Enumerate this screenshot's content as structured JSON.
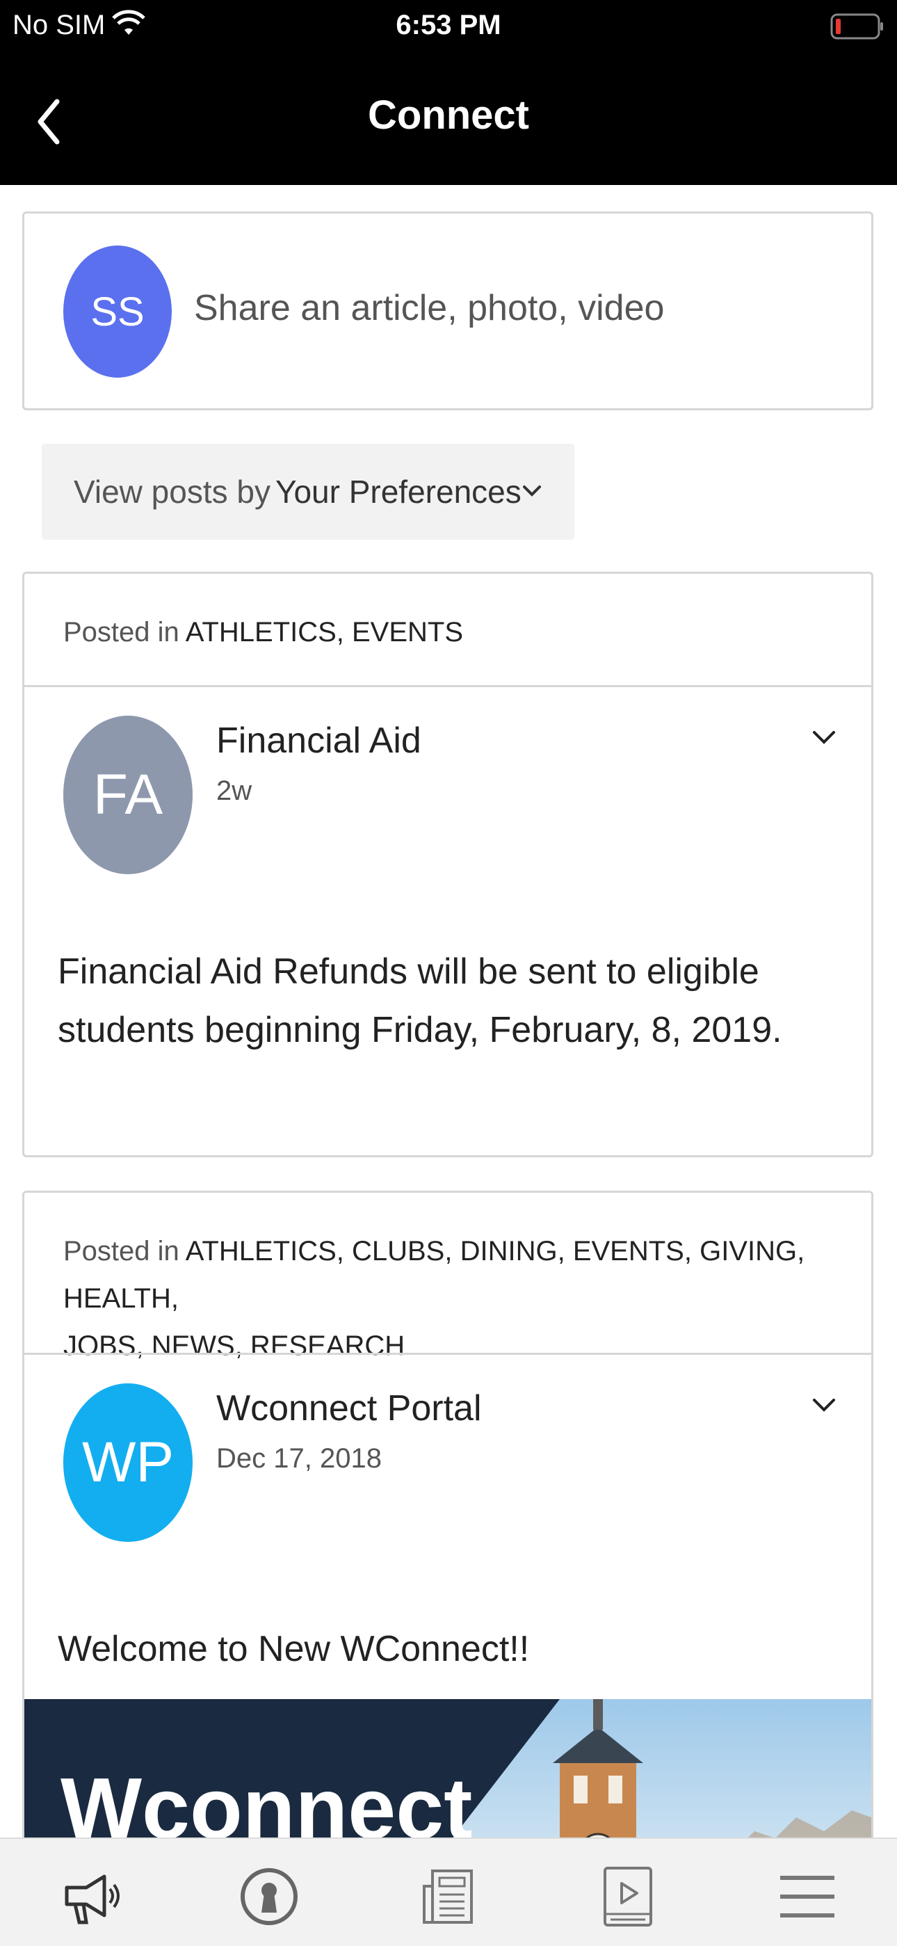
{
  "status_bar": {
    "carrier": "No SIM",
    "time": "6:53 PM",
    "wifi_icon": "wifi-icon",
    "battery_icon": "battery-low-icon"
  },
  "nav": {
    "back_icon": "chevron-left-icon",
    "title": "Connect"
  },
  "composer": {
    "avatar_initials": "SS",
    "avatar_color": "#5b70ee",
    "prompt": "Share an article, photo, video"
  },
  "filter": {
    "label": "View posts by",
    "value": "Your Preferences"
  },
  "posts": [
    {
      "posted_in_label": "Posted in",
      "categories": "ATHLETICS, EVENTS",
      "avatar_initials": "FA",
      "avatar_color": "#8e98ad",
      "author": "Financial Aid",
      "time": "2w",
      "body_line1": "Financial Aid Refunds will be sent to eligible",
      "body_line2": "students beginning Friday, February, 8, 2019."
    },
    {
      "posted_in_label": "Posted in",
      "categories_line1": "ATHLETICS, CLUBS, DINING, EVENTS, GIVING, HEALTH,",
      "categories_line2": "JOBS, NEWS, RESEARCH",
      "avatar_initials": "WP",
      "avatar_color": "#13aef0",
      "author": "Wconnect Portal",
      "time": "Dec 17, 2018",
      "body": "Welcome to New WConnect!!",
      "banner_logo_text": "Wconnect"
    }
  ],
  "tab_bar": {
    "tabs": [
      "megaphone-icon",
      "keyhole-icon",
      "newspaper-icon",
      "video-icon",
      "menu-icon"
    ]
  }
}
